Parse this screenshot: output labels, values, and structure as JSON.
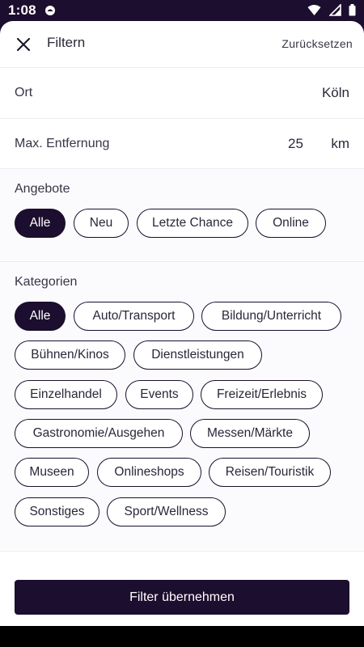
{
  "status_bar": {
    "time": "1:08"
  },
  "header": {
    "title": "Filtern",
    "reset_label": "Zurücksetzen"
  },
  "location": {
    "label": "Ort",
    "value": "Köln"
  },
  "distance": {
    "label": "Max. Entfernung",
    "value": "25",
    "unit": "km"
  },
  "offers": {
    "title": "Angebote",
    "chips": [
      {
        "label": "Alle",
        "selected": true
      },
      {
        "label": "Neu",
        "selected": false
      },
      {
        "label": "Letzte Chance",
        "selected": false
      },
      {
        "label": "Online",
        "selected": false
      }
    ]
  },
  "categories": {
    "title": "Kategorien",
    "chips": [
      {
        "label": "Alle",
        "selected": true
      },
      {
        "label": "Auto/Transport",
        "selected": false
      },
      {
        "label": "Bildung/Unterricht",
        "selected": false
      },
      {
        "label": "Bühnen/Kinos",
        "selected": false
      },
      {
        "label": "Dienstleistungen",
        "selected": false
      },
      {
        "label": "Einzelhandel",
        "selected": false
      },
      {
        "label": "Events",
        "selected": false
      },
      {
        "label": "Freizeit/Erlebnis",
        "selected": false
      },
      {
        "label": "Gastronomie/Ausgehen",
        "selected": false
      },
      {
        "label": "Messen/Märkte",
        "selected": false
      },
      {
        "label": "Museen",
        "selected": false
      },
      {
        "label": "Onlineshops",
        "selected": false
      },
      {
        "label": "Reisen/Touristik",
        "selected": false
      },
      {
        "label": "Sonstiges",
        "selected": false
      },
      {
        "label": "Sport/Wellness",
        "selected": false
      }
    ]
  },
  "apply_button": {
    "label": "Filter übernehmen"
  },
  "colors": {
    "primary": "#1c0e2e",
    "surface": "#ffffff",
    "section_bg": "#fbfbfd",
    "divider": "#ececf0"
  },
  "icons": {
    "close": "close-icon",
    "wifi": "wifi-icon",
    "signal": "signal-icon",
    "battery": "battery-icon"
  }
}
